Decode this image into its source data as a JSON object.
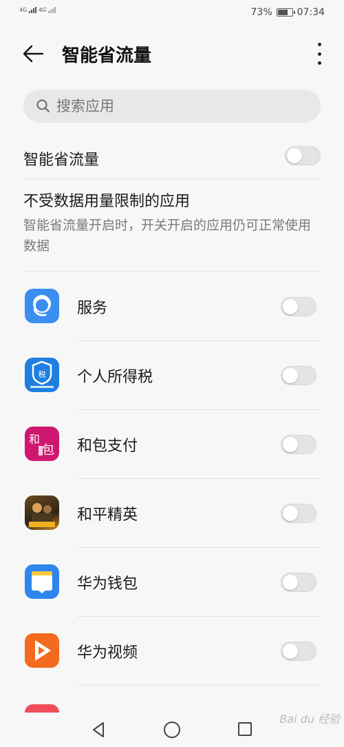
{
  "status_bar": {
    "network_left": "4G",
    "network_right": "4G",
    "battery_percent_text": "73%",
    "battery_level": 0.73,
    "time": "07:34"
  },
  "header": {
    "title": "智能省流量",
    "back_icon": "arrow-left-icon",
    "more_icon": "more-vertical-icon"
  },
  "search": {
    "placeholder": "搜索应用",
    "icon": "search-icon"
  },
  "master_toggle": {
    "label": "智能省流量",
    "on": false
  },
  "section": {
    "title": "不受数据用量限制的应用",
    "description": "智能省流量开启时，开关开启的应用仍可正常使用数据"
  },
  "apps": [
    {
      "name": "服务",
      "icon": "customer-service-icon",
      "on": false
    },
    {
      "name": "个人所得税",
      "icon": "tax-shield-icon",
      "on": false
    },
    {
      "name": "和包支付",
      "icon": "hebao-pay-icon",
      "on": false
    },
    {
      "name": "和平精英",
      "icon": "game-peace-elite-icon",
      "on": false
    },
    {
      "name": "华为钱包",
      "icon": "huawei-wallet-icon",
      "on": false
    },
    {
      "name": "华为视频",
      "icon": "huawei-video-icon",
      "on": false
    }
  ],
  "nav": {
    "back": "nav-back-icon",
    "home": "nav-home-icon",
    "recent": "nav-recent-icon"
  },
  "watermark": "Bai du 经验"
}
